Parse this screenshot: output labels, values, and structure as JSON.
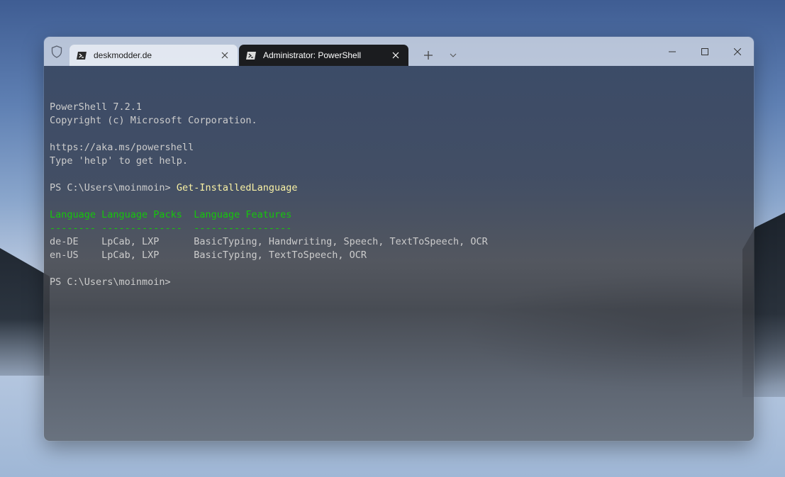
{
  "tabs": [
    {
      "label": "deskmodder.de",
      "icon": "powershell-icon",
      "active": false
    },
    {
      "label": "Administrator: PowerShell",
      "icon": "powershell-icon",
      "active": true
    }
  ],
  "terminal": {
    "banner_version": "PowerShell 7.2.1",
    "banner_copyright": "Copyright (c) Microsoft Corporation.",
    "banner_url": "https://aka.ms/powershell",
    "banner_help": "Type 'help' to get help.",
    "prompt1": "PS C:\\Users\\moinmoin> ",
    "command1": "Get-InstalledLanguage",
    "table_header": "Language Language Packs  Language Features",
    "table_rule": "-------- --------------  -----------------",
    "rows": [
      "de-DE    LpCab, LXP      BasicTyping, Handwriting, Speech, TextToSpeech, OCR",
      "en-US    LpCab, LXP      BasicTyping, TextToSpeech, OCR"
    ],
    "prompt2": "PS C:\\Users\\moinmoin>"
  },
  "colors": {
    "text": "#cccccc",
    "header": "#16c60c",
    "command": "#f9f1a5",
    "active_tab": "#1b1c1f"
  }
}
